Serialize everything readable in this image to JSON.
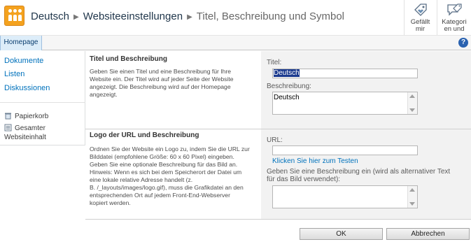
{
  "breadcrumb": {
    "site": "Deutsch",
    "settings": "Websiteeinstellungen",
    "current": "Titel, Beschreibung und Symbol"
  },
  "social": {
    "like": [
      "Gefällt",
      "mir"
    ],
    "tags": [
      "Kategori",
      "en und"
    ]
  },
  "topnav": {
    "home_tab": "Homepage",
    "help": "?"
  },
  "quicklaunch": {
    "documents": "Dokumente",
    "lists": "Listen",
    "discussions": "Diskussionen",
    "recycle_bin": "Papierkorb",
    "all_content": [
      "Gesamter",
      "Websiteinhalt"
    ]
  },
  "section_title": {
    "heading": "Titel und Beschreibung",
    "desc": [
      "Geben Sie einen Titel und eine Beschreibung für Ihre",
      "Website ein. Der Titel wird auf jeder Seite der Website",
      "angezeigt. Die Beschreibung wird auf der Homepage",
      "angezeigt."
    ],
    "title_label": "Titel:",
    "title_value": "Deutsch",
    "desc_label": "Beschreibung:",
    "desc_value": "Deutsch"
  },
  "section_logo": {
    "heading": "Logo der URL und Beschreibung",
    "desc": [
      "Ordnen Sie der Website ein Logo zu, indem Sie die URL zur",
      "Bilddatei (empfohlene Größe: 60 x 60 Pixel) eingeben.",
      "Geben Sie eine optionale Beschreibung für das Bild an.",
      "Hinweis: Wenn es sich bei dem Speicherort der Datei um",
      "eine lokale relative Adresse handelt (z.",
      "B. /_layouts/images/logo.gif), muss die Grafikdatei an den",
      "entsprechenden Ort auf jedem Front-End-Webserver",
      "kopiert werden."
    ],
    "url_label": "URL:",
    "url_value": "",
    "test_link": "Klicken Sie hier zum Testen",
    "alt_label": [
      "Geben Sie eine Beschreibung ein (wird als alternativer Text",
      "für das Bild verwendet):"
    ],
    "alt_value": ""
  },
  "buttons": {
    "ok": "OK",
    "cancel": "Abbrechen"
  },
  "colors": {
    "link": "#0072bc",
    "logo": "#f4a21e",
    "form_panel": "#f2f2f2",
    "home_tab": "#ddedf9"
  }
}
